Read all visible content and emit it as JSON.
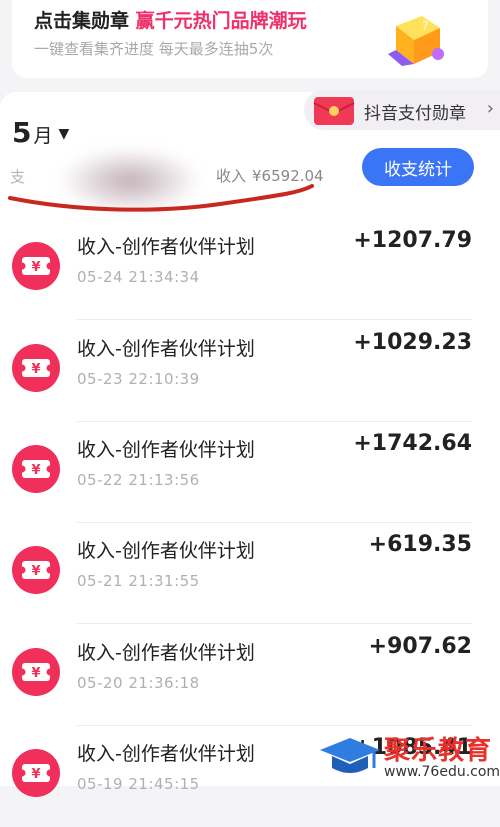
{
  "promo": {
    "title_prefix": "点击集勋章",
    "title_highlight": "赢千元热门品牌潮玩",
    "subtitle": "一键查看集齐进度 每天最多连抽5次"
  },
  "badge": {
    "label": "抖音支付勋章",
    "chevron": "›"
  },
  "header": {
    "month_number": "5",
    "month_unit": "月",
    "caret": "▼",
    "summary_left": "支",
    "income_label": "收入",
    "income_amount": "¥6592.04",
    "stats_button": "收支统计"
  },
  "transactions": [
    {
      "title": "收入-创作者伙伴计划",
      "time": "05-24 21:34:34",
      "amount": "+1207.79"
    },
    {
      "title": "收入-创作者伙伴计划",
      "time": "05-23 22:10:39",
      "amount": "+1029.23"
    },
    {
      "title": "收入-创作者伙伴计划",
      "time": "05-22 21:13:56",
      "amount": "+1742.64"
    },
    {
      "title": "收入-创作者伙伴计划",
      "time": "05-21 21:31:55",
      "amount": "+619.35"
    },
    {
      "title": "收入-创作者伙伴计划",
      "time": "05-20 21:36:18",
      "amount": "+907.62"
    },
    {
      "title": "收入-创作者伙伴计划",
      "time": "05-19 21:45:15",
      "amount": "+1085.41"
    }
  ],
  "icons": {
    "transaction": "yen-ticket-icon",
    "gift": "gift-box-icon",
    "envelope": "red-envelope-icon"
  },
  "colors": {
    "accent_blue": "#3a75f5",
    "brand_pink": "#f0306a",
    "icon_red": "#f0305a"
  },
  "watermark": {
    "name": "聚乐教育",
    "url": "www.76edu.com"
  }
}
